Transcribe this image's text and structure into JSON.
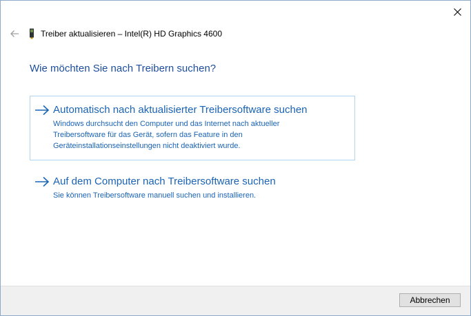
{
  "window": {
    "title": "Treiber aktualisieren – Intel(R) HD Graphics 4600"
  },
  "heading": "Wie möchten Sie nach Treibern suchen?",
  "options": [
    {
      "title": "Automatisch nach aktualisierter Treibersoftware suchen",
      "description_lines": [
        "Windows durchsucht den Computer und das Internet nach aktueller",
        "Treibersoftware für das Gerät, sofern das Feature in den",
        "Geräteinstallationseinstellungen nicht deaktiviert wurde."
      ]
    },
    {
      "title": "Auf dem Computer nach Treibersoftware suchen",
      "description_lines": [
        "Sie können Treibersoftware manuell suchen und installieren."
      ]
    }
  ],
  "footer": {
    "cancel_label": "Abbrechen"
  },
  "icons": {
    "close": "close-icon",
    "back": "back-arrow-icon",
    "device": "graphics-card-icon",
    "option_arrow": "arrow-right-icon"
  },
  "colors": {
    "accent": "#1a63b6",
    "heading": "#1e4e9b",
    "selected_border": "#aed4ef",
    "footer_bg": "#f0f0f0"
  }
}
